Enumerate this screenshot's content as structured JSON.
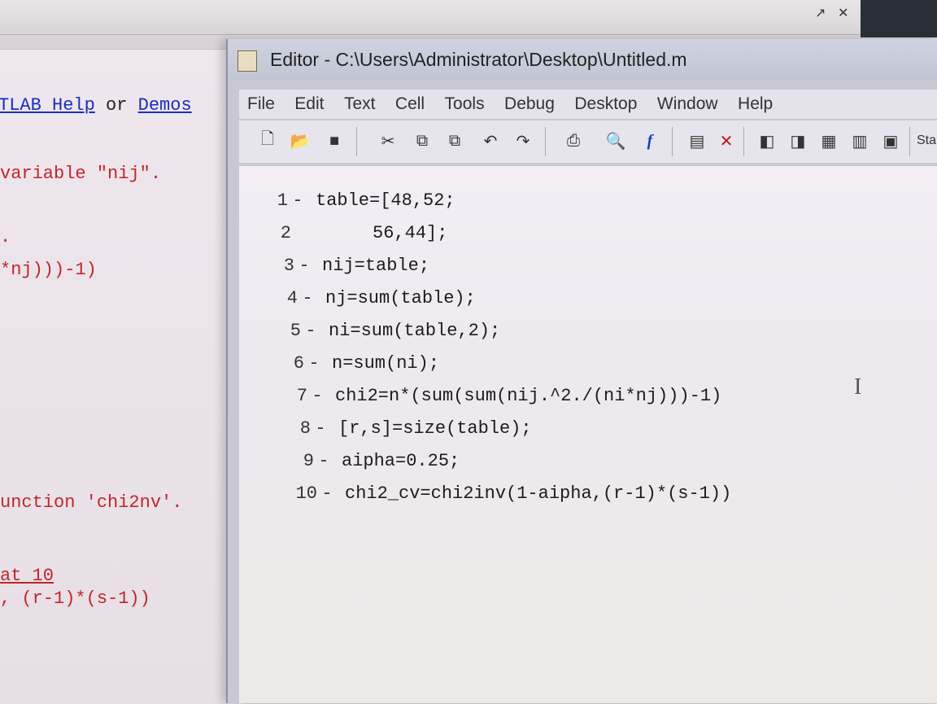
{
  "background_window": {
    "controls": [
      "↗",
      "✕"
    ],
    "command_lines": [
      {
        "type": "help",
        "prefix": "TLAB Help",
        "middle": " or ",
        "suffix": "Demos"
      },
      {
        "type": "text",
        "text": "variable \"nij\"."
      },
      {
        "type": "text",
        "text": "."
      },
      {
        "type": "text",
        "text": "*nj)))-1)"
      },
      {
        "type": "text",
        "text": "unction 'chi2nv'."
      },
      {
        "type": "text",
        "text": "at 10"
      },
      {
        "type": "text",
        "text": ", (r-1)*(s-1))"
      }
    ]
  },
  "editor": {
    "title": "Editor - C:\\Users\\Administrator\\Desktop\\Untitled.m",
    "menu": [
      "File",
      "Edit",
      "Text",
      "Cell",
      "Tools",
      "Debug",
      "Desktop",
      "Window",
      "Help"
    ],
    "toolbar_icons": [
      "new-file-icon",
      "open-folder-icon",
      "save-icon",
      "cut-icon",
      "copy-icon",
      "paste-icon",
      "undo-icon",
      "redo-icon",
      "print-icon",
      "find-icon",
      "function-icon"
    ],
    "toolbar_glyphs": [
      "🗋",
      "📂",
      "■",
      "✂",
      "⧉",
      "⧉",
      "↶",
      "↷",
      "⎙",
      "🔍",
      "f"
    ],
    "toolbar2_icons": [
      "insert-cell-icon",
      "delete-cell-icon",
      "cell-prev-icon",
      "cell-run-icon",
      "cell-next-icon",
      "cell-advance-icon",
      "cell-eval-icon"
    ],
    "toolbar2_glyphs": [
      "▤",
      "✕",
      "◧",
      "◨",
      "▦",
      "▥",
      "▣"
    ],
    "stack_label": "Sta",
    "code": [
      {
        "num": "1",
        "dash": "-",
        "text": "table=[48,52;"
      },
      {
        "num": "2",
        "dash": "",
        "text": "     56,44];"
      },
      {
        "num": "3",
        "dash": "-",
        "text": "nij=table;"
      },
      {
        "num": "4",
        "dash": "-",
        "text": "nj=sum(table);"
      },
      {
        "num": "5",
        "dash": "-",
        "text": "ni=sum(table,2);"
      },
      {
        "num": "6",
        "dash": "-",
        "text": "n=sum(ni);"
      },
      {
        "num": "7",
        "dash": "-",
        "text": "chi2=n*(sum(sum(nij.^2./(ni*nj)))-1)"
      },
      {
        "num": "8",
        "dash": "-",
        "text": "[r,s]=size(table);"
      },
      {
        "num": "9",
        "dash": "-",
        "text": "aipha=0.25;"
      },
      {
        "num": "10",
        "dash": "-",
        "text": "chi2_cv=chi2inv(1-aipha,(r-1)*(s-1))"
      }
    ]
  }
}
